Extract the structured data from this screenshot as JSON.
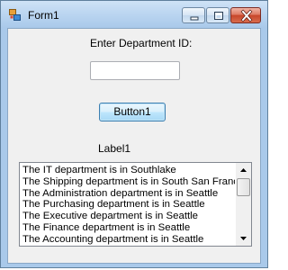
{
  "window": {
    "title": "Form1",
    "icons": {
      "app": "winforms-app-icon",
      "minimize": "minimize-icon",
      "maximize": "maximize-icon",
      "close": "close-icon"
    }
  },
  "form": {
    "dept_label": "Enter Department ID:",
    "dept_input": {
      "value": "",
      "placeholder": ""
    },
    "button_label": "Button1",
    "result_label": "Label1",
    "list_items": [
      "The IT department is in Southlake",
      "The Shipping department is in South San Francisco",
      "The Administration department is in Seattle",
      "The Purchasing department is in Seattle",
      "The Executive department is in Seattle",
      "The Finance department is in Seattle",
      "The Accounting department is in Seattle"
    ]
  },
  "colors": {
    "title_bar": "#bcd6f1",
    "client_bg": "#f0f0f0",
    "close_button": "#c7452a"
  }
}
